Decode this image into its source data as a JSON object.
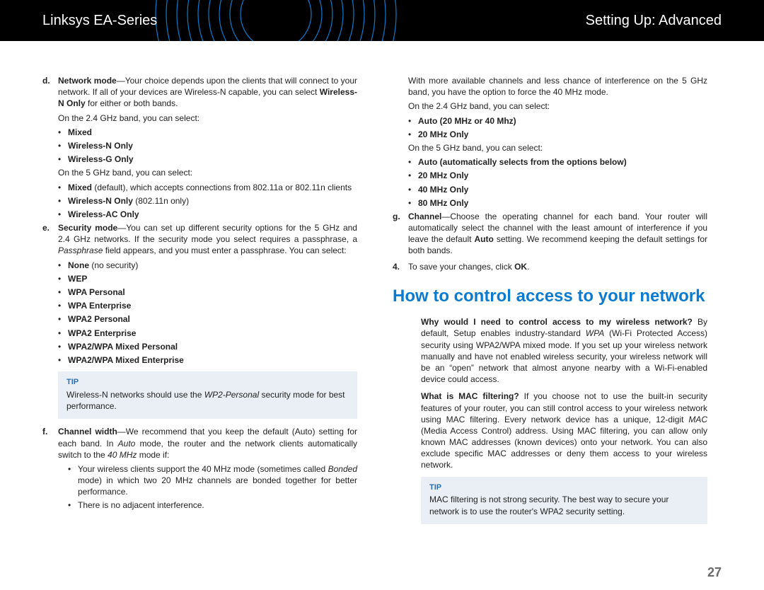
{
  "header": {
    "left": "Linksys EA-Series",
    "right": "Setting Up: Advanced"
  },
  "page_number": "27",
  "col1": {
    "d_label": "d.",
    "d_text1": "Network mode",
    "d_text2": "—Your choice depends upon the clients that will connect to your network. If all of your devices are Wireless-N capable, you can select ",
    "d_text3": "Wireless-N Only",
    "d_text4": " for either or both bands.",
    "d_sub1": "On the 2.4 GHz band, you can select:",
    "d_list1": [
      "Mixed",
      "Wireless-N Only",
      "Wireless-G Only"
    ],
    "d_sub2": "On the 5 GHz band, you can select:",
    "d_list2_item1a": "Mixed",
    "d_list2_item1b": " (default), which accepts connections from 802.11a or 802.11n clients",
    "d_list2_item2a": "Wireless-N Only",
    "d_list2_item2b": " (802.11n only)",
    "d_list2_item3": "Wireless-AC Only",
    "e_label": "e.",
    "e_text1": "Security mode",
    "e_text2": "—You can set up different security options for the 5 GHz and 2.4 GHz networks. If the security mode you select requires a passphrase, a ",
    "e_text3": "Passphrase",
    "e_text4": " field appears, and you must enter a passphrase. You can select:",
    "e_list_none_a": "None",
    "e_list_none_b": " (no security)",
    "e_list": [
      "WEP",
      "WPA Personal",
      "WPA Enterprise",
      "WPA2 Personal",
      "WPA2 Enterprise",
      "WPA2/WPA Mixed Personal",
      "WPA2/WPA Mixed Enterprise"
    ],
    "tip1_label": "TIP",
    "tip1_text_a": "Wireless-N networks should use the ",
    "tip1_text_b": "WP2-Personal",
    "tip1_text_c": " security mode for best performance.",
    "f_label": "f.",
    "f_text1": "Channel width",
    "f_text2": "—We recommend that you keep the default (Auto) setting for each band. In ",
    "f_text3": "Auto",
    "f_text4": " mode, the router and the network clients automatically switch to the ",
    "f_text5": "40 MHz",
    "f_text6": " mode if:",
    "f_list_item1a": "Your wireless clients support the 40 MHz mode (sometimes called ",
    "f_list_item1b": "Bonded",
    "f_list_item1c": " mode) in which two 20 MHz channels are bonded together for better performance.",
    "f_list_item2": "There is no adjacent interference."
  },
  "col2": {
    "top_para": "With more available channels and less chance of interference on the 5 GHz band, you have the option to force the 40 MHz mode.",
    "sub1": "On the 2.4 GHz band, you can select:",
    "list1": [
      "Auto (20 MHz or 40 Mhz)",
      "20 MHz Only"
    ],
    "sub2": "On the 5 GHz band, you can select:",
    "list2": [
      "Auto (automatically selects from the options below)",
      "20 MHz Only",
      "40 MHz Only",
      "80 MHz Only"
    ],
    "g_label": "g.",
    "g_text1": "Channel",
    "g_text2": "—Choose the operating channel for each band. Your router will automatically select the channel with the least amount of interference if you leave the default ",
    "g_text3": "Auto",
    "g_text4": " setting. We recommend keeping the default settings for both bands.",
    "num4_label": "4.",
    "num4_text_a": "To save your changes, click ",
    "num4_text_b": "OK",
    "num4_text_c": ".",
    "section_title": "How to control access to your network",
    "para1_a": "Why would I need to control access to my wireless network?",
    "para1_b": " By default, Setup enables industry-standard ",
    "para1_c": "WPA",
    "para1_d": " (Wi-Fi Protected Access) security using WPA2/WPA mixed mode. If you set up your wireless network manually and have not enabled wireless security, your wireless network will be an “open” network that almost anyone nearby with a Wi-Fi-enabled device could access.",
    "para2_a": "What is MAC filtering?",
    "para2_b": " If you choose not to use the built-in security features of your router, you can still control access to your wireless network using MAC filtering. Every network device has a unique, 12-digit ",
    "para2_c": "MAC",
    "para2_d": " (Media Access Control) address. Using MAC filtering, you can allow only known MAC addresses (known devices) onto your network. You can also exclude specific MAC addresses or deny them access to your wireless network.",
    "tip2_label": "TIP",
    "tip2_text": "MAC filtering is not strong security. The best way to secure your network is to use the router's WPA2 security setting."
  }
}
